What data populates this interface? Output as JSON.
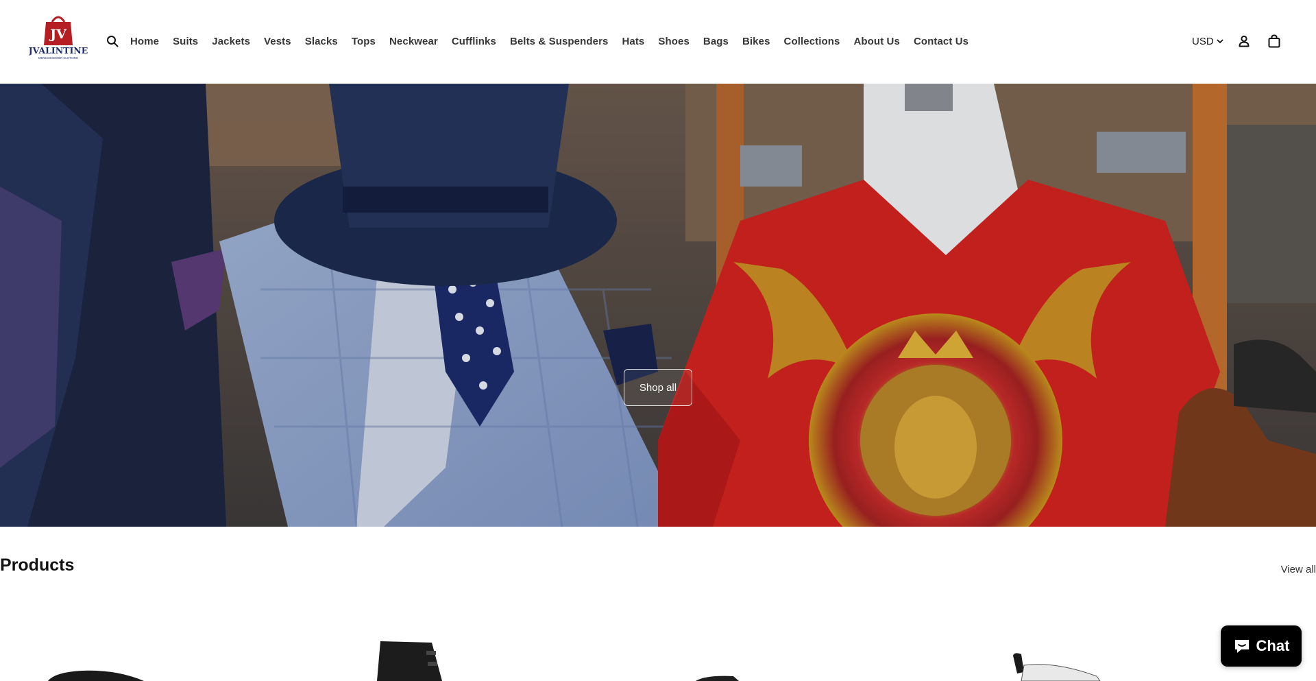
{
  "header": {
    "logo_text": "JVALINTINE",
    "logo_monogram": "JV",
    "logo_tagline": "MENS DESIGNER CLOTHING",
    "search_icon": "search-icon",
    "nav": [
      {
        "label": "Home"
      },
      {
        "label": "Suits"
      },
      {
        "label": "Jackets"
      },
      {
        "label": "Vests"
      },
      {
        "label": "Slacks"
      },
      {
        "label": "Tops"
      },
      {
        "label": "Neckwear"
      },
      {
        "label": "Cufflinks"
      },
      {
        "label": "Belts & Suspenders"
      },
      {
        "label": "Hats"
      },
      {
        "label": "Shoes"
      },
      {
        "label": "Bags"
      },
      {
        "label": "Bikes"
      },
      {
        "label": "Collections"
      },
      {
        "label": "About Us"
      },
      {
        "label": "Contact Us"
      }
    ],
    "currency": "USD",
    "account_icon": "account-icon",
    "cart_icon": "cart-icon"
  },
  "hero": {
    "button_label": "Shop all"
  },
  "products": {
    "title": "Products",
    "view_all": "View all"
  },
  "chat": {
    "label": "Chat"
  },
  "colors": {
    "logo_red": "#b51f24",
    "logo_navy": "#1d2d6b",
    "chat_bg": "#000000"
  }
}
